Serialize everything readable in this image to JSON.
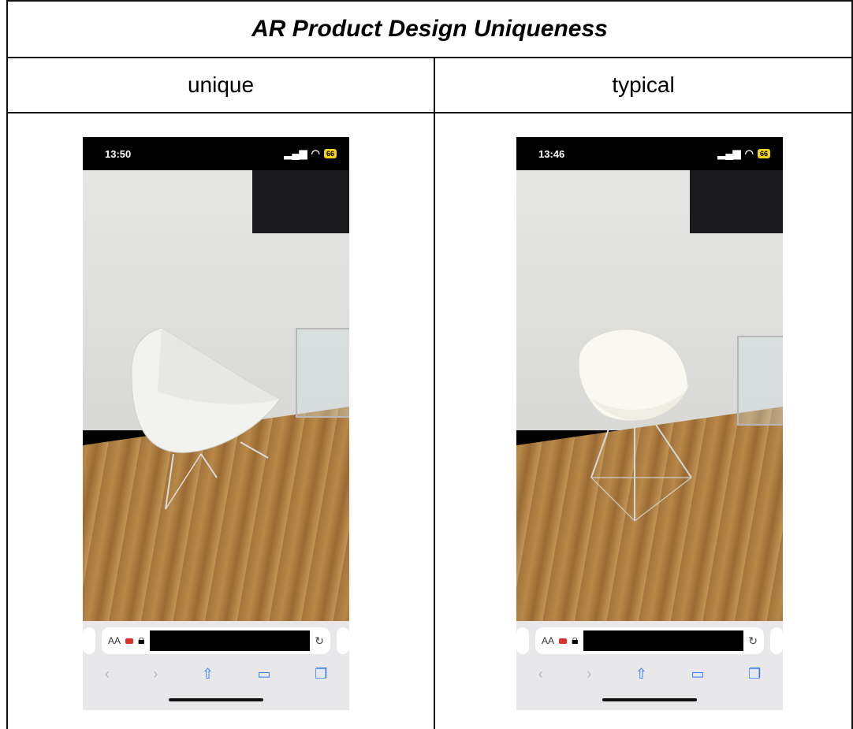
{
  "table": {
    "title": "AR Product Design Uniqueness",
    "columns": [
      {
        "header": "unique",
        "phone": {
          "time": "13:50",
          "battery": "66",
          "url_prefix": "AA",
          "chair": "white triangular coconut-style lounge chair on wire legs"
        }
      },
      {
        "header": "typical",
        "phone": {
          "time": "13:46",
          "battery": "66",
          "url_prefix": "AA",
          "chair": "white molded shell armchair on wire Eiffel base"
        }
      }
    ]
  },
  "icons": {
    "status": [
      "signal-icon",
      "wifi-icon",
      "battery-icon"
    ],
    "toolbar": [
      "back-icon",
      "forward-icon",
      "share-icon",
      "bookmarks-icon",
      "tabs-icon"
    ]
  },
  "colors": {
    "border": "#111111",
    "wall": "#e0e0de",
    "floor": "#b0803f",
    "battery": "#f2d11a",
    "toolbar_accent": "#2f7cf6",
    "record": "#e0302a"
  }
}
